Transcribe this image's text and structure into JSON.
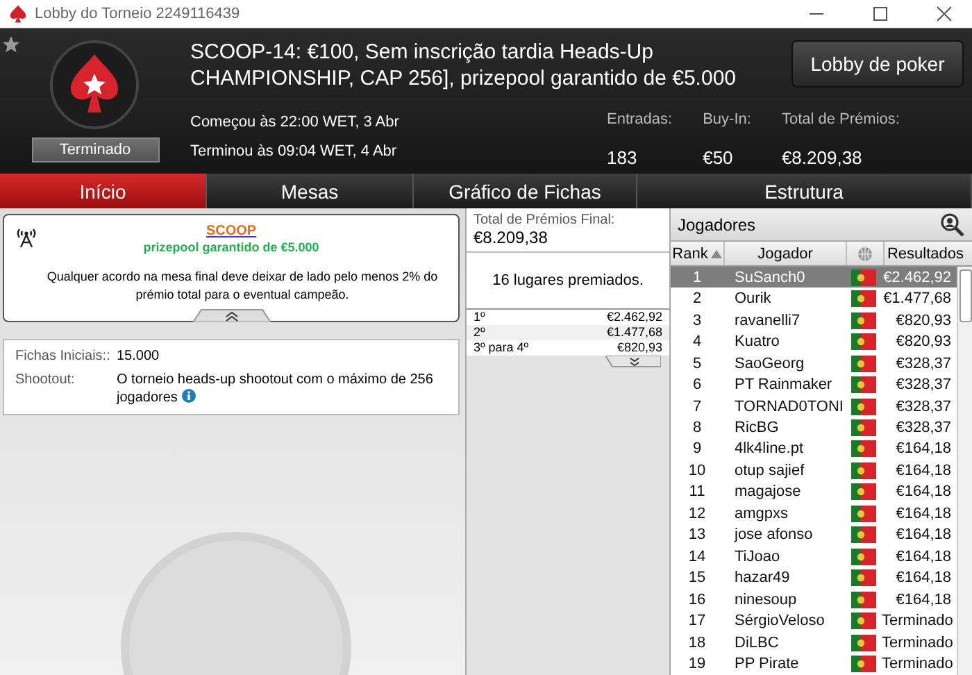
{
  "window": {
    "title": "Lobby do Torneio 2249116439"
  },
  "header": {
    "title": "SCOOP-14: €100, Sem inscrição tardia Heads-Up CHAMPIONSHIP, CAP 256], prizepool garantido de €5.000",
    "status": "Terminado",
    "lobby_button": "Lobby de poker",
    "started": "Começou às 22:00 WET, 3 Abr",
    "ended": "Terminou às 09:04 WET, 4 Abr",
    "stats": [
      {
        "label": "Entradas:",
        "value": "183"
      },
      {
        "label": "Buy-In:",
        "value": "€50"
      },
      {
        "label": "Total de Prémios:",
        "value": "€8.209,38"
      }
    ]
  },
  "tabs": [
    {
      "label": "Início",
      "selected": true
    },
    {
      "label": "Mesas",
      "selected": false
    },
    {
      "label": "Gráfico de Fichas",
      "selected": false
    },
    {
      "label": "Estrutura",
      "selected": false
    }
  ],
  "info": {
    "link": "SCOOP",
    "guarantee": "prizepool garantido de €5.000",
    "note": "Qualquer acordo na mesa final deve deixar de lado pelo menos 2% do prémio total para o eventual campeão."
  },
  "details": [
    {
      "label": "Fichas Iniciais::",
      "value": "15.000"
    },
    {
      "label": "Shootout:",
      "value": "O torneio heads-up shootout com o máximo de 256 jogadores"
    }
  ],
  "prizes": {
    "label": "Total de Prémios Final:",
    "total": "€8.209,38",
    "places": "16 lugares premiados.",
    "rows": [
      {
        "place": "1º",
        "amount": "€2.462,92"
      },
      {
        "place": "2º",
        "amount": "€1.477,68"
      },
      {
        "place": "3º para 4º",
        "amount": "€820,93"
      }
    ]
  },
  "players": {
    "title": "Jogadores",
    "columns": [
      "Rank",
      "Jogador",
      "Resultados"
    ],
    "rows": [
      {
        "rank": "1",
        "name": "SuSanch0",
        "result": "€2.462,92",
        "selected": true
      },
      {
        "rank": "2",
        "name": "Ourik",
        "result": "€1.477,68",
        "selected": false
      },
      {
        "rank": "3",
        "name": "ravanelli7",
        "result": "€820,93",
        "selected": false
      },
      {
        "rank": "4",
        "name": "Kuatro",
        "result": "€820,93",
        "selected": false
      },
      {
        "rank": "5",
        "name": "SaoGeorg",
        "result": "€328,37",
        "selected": false
      },
      {
        "rank": "6",
        "name": "PT Rainmaker",
        "result": "€328,37",
        "selected": false
      },
      {
        "rank": "7",
        "name": "TORNAD0TONI",
        "result": "€328,37",
        "selected": false
      },
      {
        "rank": "8",
        "name": "RicBG",
        "result": "€328,37",
        "selected": false
      },
      {
        "rank": "9",
        "name": "4lk4line.pt",
        "result": "€164,18",
        "selected": false
      },
      {
        "rank": "10",
        "name": "otup sajief",
        "result": "€164,18",
        "selected": false
      },
      {
        "rank": "11",
        "name": "magajose",
        "result": "€164,18",
        "selected": false
      },
      {
        "rank": "12",
        "name": "amgpxs",
        "result": "€164,18",
        "selected": false
      },
      {
        "rank": "13",
        "name": "jose afonso",
        "result": "€164,18",
        "selected": false
      },
      {
        "rank": "14",
        "name": "TiJoao",
        "result": "€164,18",
        "selected": false
      },
      {
        "rank": "15",
        "name": "hazar49",
        "result": "€164,18",
        "selected": false
      },
      {
        "rank": "16",
        "name": "ninesoup",
        "result": "€164,18",
        "selected": false
      },
      {
        "rank": "17",
        "name": "SérgioVeloso",
        "result": "Terminado",
        "selected": false
      },
      {
        "rank": "18",
        "name": "DiLBC",
        "result": "Terminado",
        "selected": false
      },
      {
        "rank": "19",
        "name": "PP Pirate",
        "result": "Terminado",
        "selected": false
      }
    ]
  }
}
